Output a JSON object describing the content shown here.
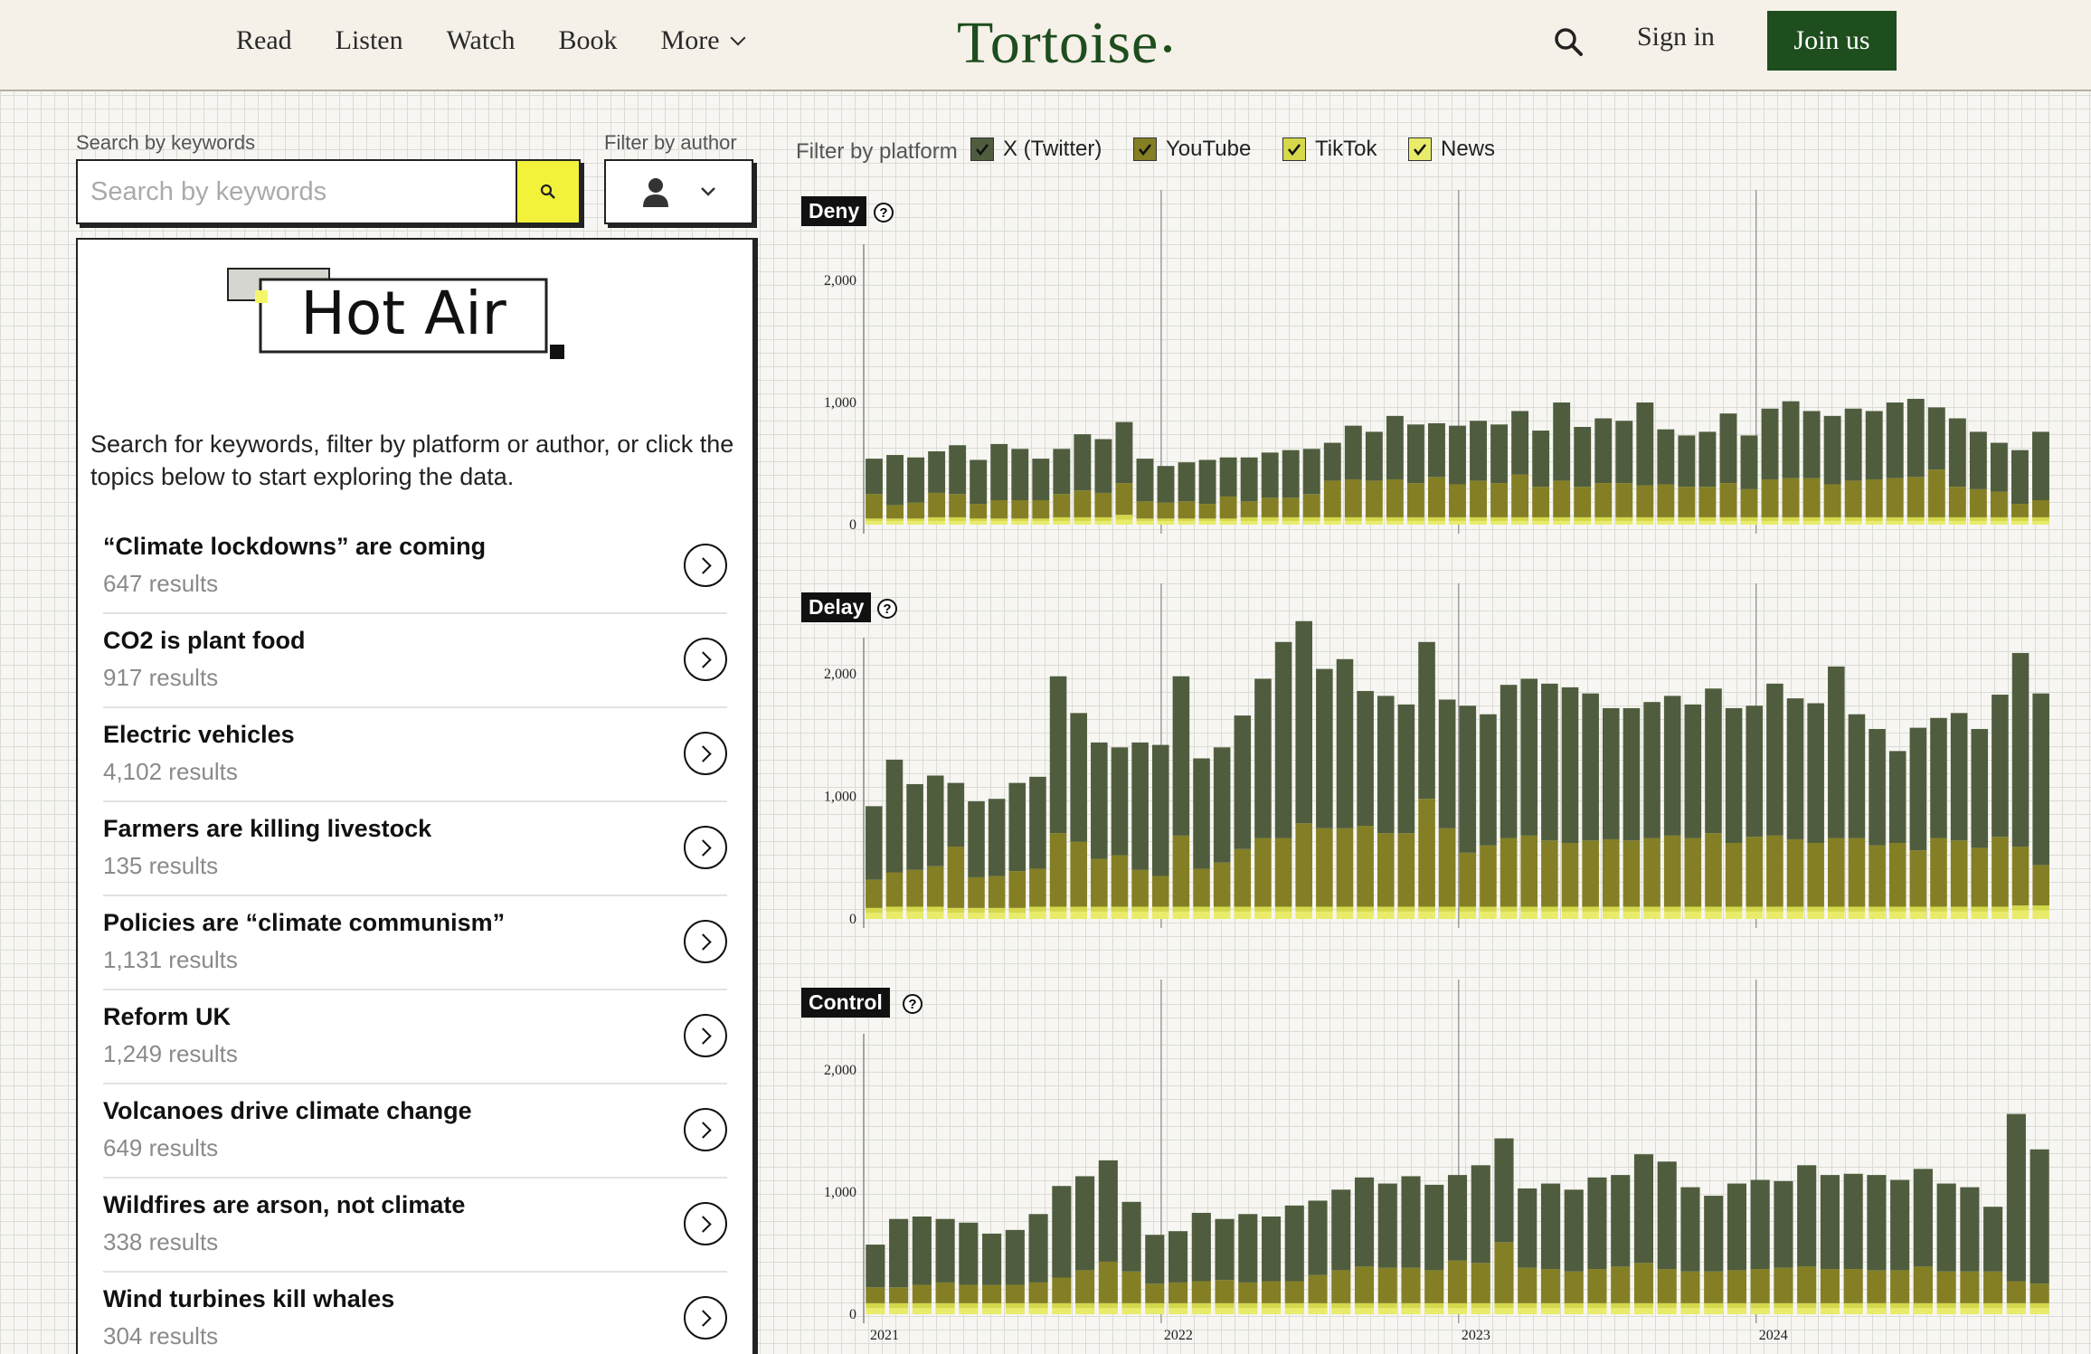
{
  "nav": {
    "items": [
      "Read",
      "Listen",
      "Watch",
      "Book",
      "More"
    ],
    "logo": "Tortoise",
    "signin": "Sign in",
    "join": "Join us"
  },
  "search": {
    "label": "Search by keywords",
    "placeholder": "Search by keywords",
    "author_label": "Filter by author"
  },
  "panel": {
    "logo_text": "Hot Air",
    "intro": "Search for keywords, filter by platform or author, or click the topics below to start exploring the data.",
    "topics": [
      {
        "title": "“Climate lockdowns” are coming",
        "count": "647 results"
      },
      {
        "title": "CO2 is plant food",
        "count": "917 results"
      },
      {
        "title": "Electric vehicles",
        "count": "4,102 results"
      },
      {
        "title": "Farmers are killing livestock",
        "count": "135 results"
      },
      {
        "title": "Policies are “climate communism”",
        "count": "1,131 results"
      },
      {
        "title": "Reform UK",
        "count": "1,249 results"
      },
      {
        "title": "Volcanoes drive climate change",
        "count": "649 results"
      },
      {
        "title": "Wildfires are arson, not climate",
        "count": "338 results"
      },
      {
        "title": "Wind turbines kill whales",
        "count": "304 results"
      }
    ]
  },
  "platform": {
    "label": "Filter by platform",
    "options": [
      {
        "label": "X (Twitter)",
        "color": "#4f5d3e"
      },
      {
        "label": "YouTube",
        "color": "#847f24"
      },
      {
        "label": "TikTok",
        "color": "#d4d84a"
      },
      {
        "label": "News",
        "color": "#e8ec6a"
      }
    ]
  },
  "chart_data": [
    {
      "type": "bar",
      "title": "Deny",
      "stacked": true,
      "ylim": [
        0,
        2000
      ],
      "yticks": [
        "0",
        "1,000",
        "2,000"
      ],
      "xticks": [
        "2021",
        "2022",
        "2023",
        "2024"
      ],
      "series": [
        {
          "name": "X (Twitter)",
          "values": [
            290,
            410,
            370,
            340,
            400,
            360,
            460,
            420,
            340,
            370,
            460,
            440,
            500,
            350,
            300,
            320,
            360,
            320,
            360,
            370,
            390,
            370,
            310,
            440,
            400,
            520,
            480,
            440,
            480,
            490,
            480,
            520,
            460,
            640,
            490,
            530,
            510,
            680,
            450,
            420,
            450,
            570,
            440,
            580,
            630,
            550,
            560,
            590,
            560,
            620,
            640,
            510,
            560,
            470,
            400,
            440,
            560
          ]
        },
        {
          "name": "YouTube",
          "values": [
            200,
            110,
            130,
            200,
            190,
            120,
            150,
            150,
            150,
            190,
            220,
            200,
            260,
            140,
            130,
            140,
            120,
            180,
            130,
            160,
            160,
            190,
            300,
            310,
            300,
            310,
            280,
            330,
            270,
            300,
            280,
            350,
            250,
            300,
            250,
            280,
            280,
            260,
            270,
            250,
            250,
            280,
            230,
            310,
            320,
            320,
            270,
            300,
            310,
            320,
            330,
            390,
            250,
            230,
            210,
            110,
            140
          ]
        },
        {
          "name": "TikTok",
          "values": [
            20,
            20,
            20,
            30,
            30,
            20,
            20,
            20,
            20,
            30,
            30,
            30,
            40,
            20,
            20,
            20,
            20,
            20,
            30,
            30,
            30,
            30,
            30,
            30,
            30,
            30,
            30,
            30,
            30,
            30,
            30,
            30,
            30,
            30,
            30,
            30,
            30,
            30,
            30,
            30,
            30,
            30,
            30,
            30,
            30,
            30,
            30,
            30,
            30,
            30,
            30,
            30,
            30,
            30,
            30,
            30,
            30
          ]
        },
        {
          "name": "News",
          "values": [
            30,
            30,
            30,
            30,
            30,
            30,
            30,
            30,
            30,
            30,
            30,
            30,
            40,
            30,
            30,
            30,
            30,
            30,
            30,
            30,
            30,
            30,
            30,
            30,
            30,
            30,
            30,
            30,
            30,
            30,
            30,
            30,
            30,
            30,
            30,
            30,
            30,
            30,
            30,
            30,
            30,
            30,
            30,
            30,
            30,
            30,
            30,
            30,
            30,
            30,
            30,
            30,
            30,
            30,
            30,
            30,
            30
          ]
        }
      ]
    },
    {
      "type": "bar",
      "title": "Delay",
      "stacked": true,
      "ylim": [
        0,
        2000
      ],
      "yticks": [
        "0",
        "1,000",
        "2,000"
      ],
      "xticks": [
        "2021",
        "2022",
        "2023",
        "2024"
      ],
      "series": [
        {
          "name": "X (Twitter)",
          "values": [
            600,
            920,
            700,
            740,
            520,
            620,
            630,
            720,
            750,
            1280,
            1050,
            950,
            880,
            1040,
            1070,
            1300,
            900,
            940,
            1090,
            1300,
            1600,
            1650,
            1300,
            1380,
            1100,
            1120,
            1050,
            1280,
            1050,
            1200,
            1070,
            1250,
            1280,
            1280,
            1270,
            1200,
            1070,
            1080,
            1110,
            1140,
            1090,
            1180,
            1100,
            1070,
            1240,
            1150,
            1140,
            1400,
            1010,
            950,
            750,
            1000,
            980,
            1040,
            970,
            1160,
            1580,
            1400
          ]
        },
        {
          "name": "YouTube",
          "values": [
            230,
            280,
            300,
            330,
            500,
            250,
            260,
            300,
            310,
            600,
            530,
            390,
            420,
            300,
            250,
            580,
            310,
            360,
            470,
            560,
            560,
            680,
            640,
            640,
            660,
            600,
            600,
            880,
            640,
            440,
            500,
            560,
            580,
            540,
            520,
            540,
            550,
            540,
            560,
            580,
            560,
            600,
            520,
            570,
            580,
            550,
            520,
            560,
            560,
            500,
            520,
            460,
            560,
            540,
            480,
            570,
            480,
            330
          ]
        },
        {
          "name": "TikTok",
          "values": [
            40,
            40,
            40,
            40,
            40,
            40,
            40,
            40,
            40,
            40,
            40,
            40,
            40,
            40,
            40,
            40,
            40,
            40,
            40,
            40,
            40,
            40,
            40,
            40,
            40,
            40,
            40,
            40,
            40,
            40,
            40,
            40,
            40,
            40,
            40,
            40,
            40,
            40,
            40,
            40,
            40,
            40,
            40,
            40,
            40,
            40,
            40,
            40,
            40,
            40,
            40,
            40,
            40,
            40,
            40,
            40,
            40,
            40
          ]
        },
        {
          "name": "News",
          "values": [
            50,
            60,
            60,
            60,
            50,
            50,
            50,
            50,
            60,
            60,
            60,
            60,
            60,
            60,
            60,
            60,
            60,
            60,
            60,
            60,
            60,
            60,
            60,
            60,
            60,
            60,
            60,
            60,
            60,
            60,
            60,
            60,
            60,
            60,
            60,
            60,
            60,
            60,
            60,
            60,
            60,
            60,
            60,
            60,
            60,
            60,
            60,
            60,
            60,
            60,
            60,
            60,
            60,
            60,
            60,
            60,
            70,
            70
          ]
        }
      ]
    },
    {
      "type": "bar",
      "title": "Control",
      "stacked": true,
      "ylim": [
        0,
        2000
      ],
      "yticks": [
        "0",
        "1,000",
        "2,000"
      ],
      "xticks": [
        "2021",
        "2022",
        "2023",
        "2024"
      ],
      "series": [
        {
          "name": "X (Twitter)",
          "values": [
            350,
            560,
            560,
            520,
            510,
            420,
            450,
            560,
            750,
            770,
            830,
            570,
            400,
            420,
            560,
            500,
            560,
            530,
            620,
            610,
            660,
            730,
            690,
            750,
            700,
            700,
            800,
            850,
            650,
            700,
            670,
            750,
            750,
            890,
            880,
            690,
            620,
            710,
            730,
            710,
            830,
            770,
            780,
            780,
            740,
            800,
            720,
            690,
            530,
            1370,
            1100
          ]
        },
        {
          "name": "YouTube",
          "values": [
            130,
            130,
            150,
            170,
            150,
            150,
            150,
            170,
            210,
            270,
            340,
            260,
            160,
            170,
            180,
            190,
            170,
            180,
            180,
            230,
            270,
            300,
            290,
            290,
            270,
            350,
            330,
            500,
            290,
            280,
            260,
            280,
            300,
            330,
            280,
            260,
            260,
            270,
            280,
            290,
            300,
            280,
            280,
            270,
            270,
            300,
            260,
            260,
            260,
            180,
            160
          ]
        },
        {
          "name": "TikTok",
          "values": [
            40,
            40,
            40,
            40,
            40,
            40,
            40,
            40,
            40,
            40,
            40,
            40,
            40,
            40,
            40,
            40,
            40,
            40,
            40,
            40,
            40,
            40,
            40,
            40,
            40,
            40,
            40,
            40,
            40,
            40,
            40,
            40,
            40,
            40,
            40,
            40,
            40,
            40,
            40,
            40,
            40,
            40,
            40,
            40,
            40,
            40,
            40,
            40,
            40,
            40,
            40
          ]
        },
        {
          "name": "News",
          "values": [
            50,
            50,
            50,
            50,
            50,
            50,
            50,
            50,
            50,
            50,
            50,
            50,
            50,
            50,
            50,
            50,
            50,
            50,
            50,
            50,
            50,
            50,
            50,
            50,
            50,
            50,
            50,
            50,
            50,
            50,
            50,
            50,
            50,
            50,
            50,
            50,
            50,
            50,
            50,
            50,
            50,
            50,
            50,
            50,
            50,
            50,
            50,
            50,
            50,
            50,
            50
          ]
        }
      ]
    }
  ]
}
